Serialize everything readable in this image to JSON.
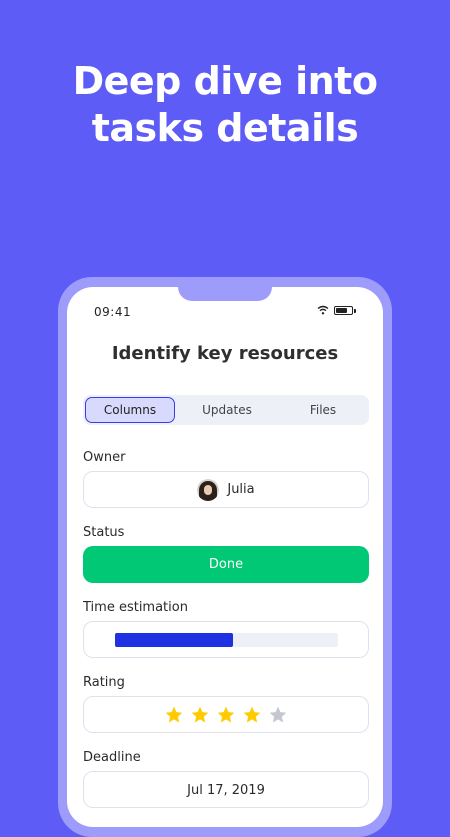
{
  "hero": {
    "line1": "Deep dive into",
    "line2": "tasks details"
  },
  "status_bar": {
    "time": "09:41"
  },
  "task": {
    "title": "Identify key resources"
  },
  "tabs": [
    {
      "label": "Columns",
      "active": true
    },
    {
      "label": "Updates",
      "active": false
    },
    {
      "label": "Files",
      "active": false
    }
  ],
  "fields": {
    "owner": {
      "label": "Owner",
      "name": "Julia"
    },
    "status": {
      "label": "Status",
      "value": "Done",
      "color": "#00c875"
    },
    "time_estimation": {
      "label": "Time estimation",
      "progress": 0.53,
      "color": "#1f31e0"
    },
    "rating": {
      "label": "Rating",
      "value": 4,
      "max": 5,
      "filled_color": "#ffcb00",
      "empty_color": "#c5c7d0"
    },
    "deadline": {
      "label": "Deadline",
      "value": "Jul 17, 2019"
    }
  },
  "colors": {
    "background": "#5e5cf6",
    "phone_frame": "#9d9cfb",
    "accent": "#3a3ae8"
  },
  "icons": [
    "wifi-icon",
    "battery-icon",
    "star-icon"
  ]
}
